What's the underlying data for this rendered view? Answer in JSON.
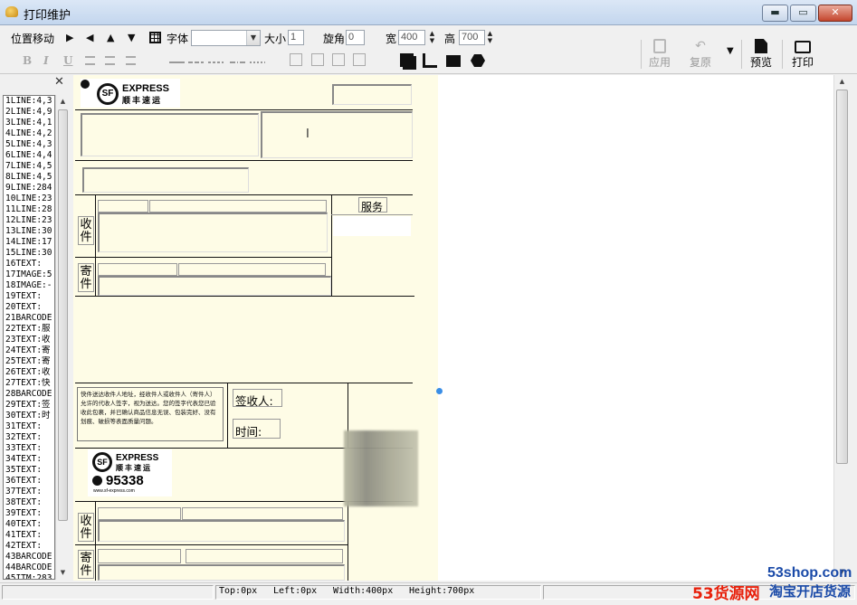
{
  "window": {
    "title": "打印维护",
    "min": "▬",
    "max": "▭",
    "close": "✕"
  },
  "toolbar": {
    "position_move": "位置移动",
    "arrows": [
      "▶",
      "◀",
      "▲",
      "▼"
    ],
    "font_label": "字体",
    "size_label": "大小",
    "size_value": "1",
    "rotate_label": "旋角",
    "rotate_value": "0",
    "width_label": "宽",
    "width_value": "400",
    "height_label": "高",
    "height_value": "700",
    "format_bold": "B",
    "format_italic": "I",
    "format_underline": "U",
    "apply_label": "应用",
    "restore_label": "复原",
    "preview_label": "预览",
    "print_label": "打印"
  },
  "left_list": {
    "items": [
      "1LINE:4,3",
      "2LINE:4,9",
      "3LINE:4,1",
      "4LINE:4,2",
      "5LINE:4,3",
      "6LINE:4,4",
      "7LINE:4,5",
      "8LINE:4,5",
      "9LINE:284",
      "10LINE:23",
      "11LINE:28",
      "12LINE:23",
      "13LINE:30",
      "14LINE:17",
      "15LINE:30",
      "16TEXT:",
      "17IMAGE:5",
      "18IMAGE:-",
      "19TEXT:",
      "20TEXT:",
      "21BARCODE",
      "22TEXT:服",
      "23TEXT:收",
      "24TEXT:寄",
      "25TEXT:寄",
      "26TEXT:收",
      "27TEXT:快",
      "28BARCODE",
      "29TEXT:签",
      "30TEXT:时",
      "31TEXT:",
      "32TEXT:",
      "33TEXT:",
      "34TEXT:",
      "35TEXT:",
      "36TEXT:",
      "37TEXT:",
      "38TEXT:",
      "39TEXT:",
      "40TEXT:",
      "41TEXT:",
      "42TEXT:",
      "43BARCODE",
      "44BARCODE",
      "45ITM:283"
    ]
  },
  "canvas": {
    "logo_top": {
      "sf": "SF",
      "express": "EXPRESS",
      "cn": "顺丰速运"
    },
    "service_label": "服务",
    "receive_label": "收件",
    "send_label": "寄件",
    "notice_text": "快件送达收件人地址，经收件人或收件人（寄件人）允许的代收人签字，视为送达。您的签字代表您已验收此包裹，并已确认商品信息无误、包装完好、没有划痕、破损等表面质量问题。",
    "signer_label": "签收人:",
    "time_label": "时间:",
    "logo_bottom": {
      "sf": "SF",
      "express": "EXPRESS",
      "cn": "顺丰速运",
      "phone": "95338",
      "url": "www.sf-express.com"
    },
    "receive_label_2": "收件",
    "send_label_2": "寄件"
  },
  "status": {
    "top": "Top:0px",
    "left": "Left:0px",
    "width": "Width:400px",
    "height": "Height:700px"
  },
  "watermark": {
    "site": "53shop.com",
    "brand": "53货源网",
    "slogan": "淘宝开店货源"
  },
  "colors": {
    "paper": "#fefce6",
    "accent_red": "#e8200b",
    "accent_blue": "#1a4aa8"
  }
}
